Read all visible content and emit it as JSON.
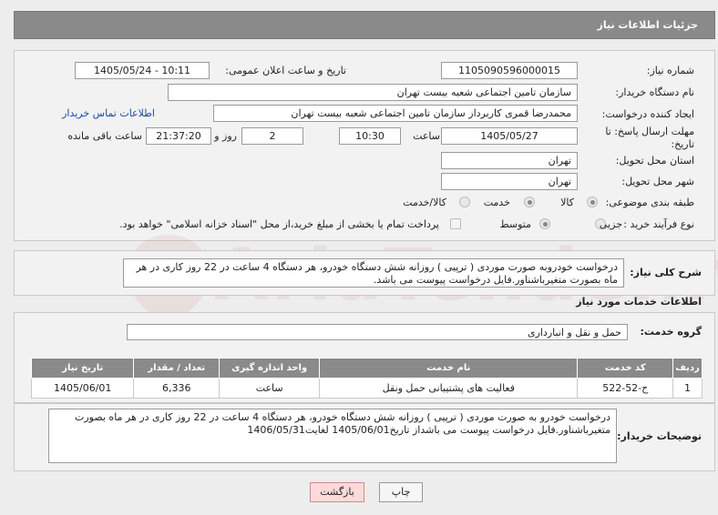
{
  "header": {
    "title": "جزئیات اطلاعات نیاز"
  },
  "fields": {
    "need_number_label": "شماره نیاز:",
    "need_number": "1105090596000015",
    "announce_label": "تاریخ و ساعت اعلان عمومی:",
    "announce_value": "1405/05/24 - 10:11",
    "buyer_org_label": "نام دستگاه خریدار:",
    "buyer_org": "سازمان تامین اجتماعی شعبه بیست تهران",
    "creator_label": "ایجاد کننده درخواست:",
    "creator": "محمدرضا قمری کاربرداز  سازمان تامین اجتماعی شعبه بیست تهران",
    "contact_link": "اطلاعات تماس خریدار",
    "deadline_label_1": "مهلت ارسال پاسخ: تا",
    "deadline_label_2": "تاریخ:",
    "deadline_date": "1405/05/27",
    "time_label": "ساعت",
    "deadline_time": "10:30",
    "days_value": "2",
    "days_label": "روز و",
    "remaining_time": "21:37:20",
    "remaining_label": "ساعت باقی مانده",
    "province_label": "استان محل تحویل:",
    "province": "تهران",
    "city_label": "شهر محل تحویل:",
    "city": "تهران",
    "category_label": "طبقه بندی موضوعی:",
    "category_options": [
      "کالا",
      "خدمت",
      "کالا/خدمت"
    ],
    "purchase_type_label": "نوع فرآیند خرید :",
    "purchase_options": [
      "جزیی",
      "متوسط"
    ],
    "payment_note": "پرداخت تمام یا بخشی از مبلغ خرید،از محل \"اسناد خزانه اسلامی\" خواهد بود."
  },
  "description": {
    "label": "شرح کلی نیاز:",
    "text": "درخواست خودروبه صورت موردی ( ترپیی ) روزانه شش دستگاه خودرو، هر دستگاه 4 ساعت در 22 روز کاری در هر ماه بصورت متغیرباشناور.فایل درخواست پیوست می باشد."
  },
  "services": {
    "section_title": "اطلاعات خدمات مورد نیاز",
    "group_label": "گروه خدمت:",
    "group_value": "حمل و نقل و انبارداری",
    "columns": [
      "ردیف",
      "کد خدمت",
      "نام خدمت",
      "واحد اندازه گیری",
      "تعداد / مقدار",
      "تاریخ نیاز"
    ],
    "rows": [
      {
        "row": "1",
        "code": "ح-52-522",
        "name": "فعالیت های پشتیبانی حمل ونقل",
        "unit": "ساعت",
        "qty": "6,336",
        "date": "1405/06/01"
      }
    ]
  },
  "buyer_notes": {
    "label": "توضیحات خریدار:",
    "text": "درخواست خودرو به صورت موردی ( ترپیی ) روزانه شش دستگاه خودرو، هر دستگاه 4 ساعت در 22 روز کاری در هر ماه بصورت متغیرباشناور.فایل درخواست پیوست می باشداز تاریخ1405/06/01 لغایت1406/05/31"
  },
  "buttons": {
    "print": "چاپ",
    "back": "بازگشت"
  },
  "watermark": {
    "text": "AriaTender.net"
  },
  "colors": {
    "header_bg": "#8a8a8a",
    "link": "#1a4aa8",
    "back_btn": "#fbdada",
    "watermark": "#d27878"
  }
}
